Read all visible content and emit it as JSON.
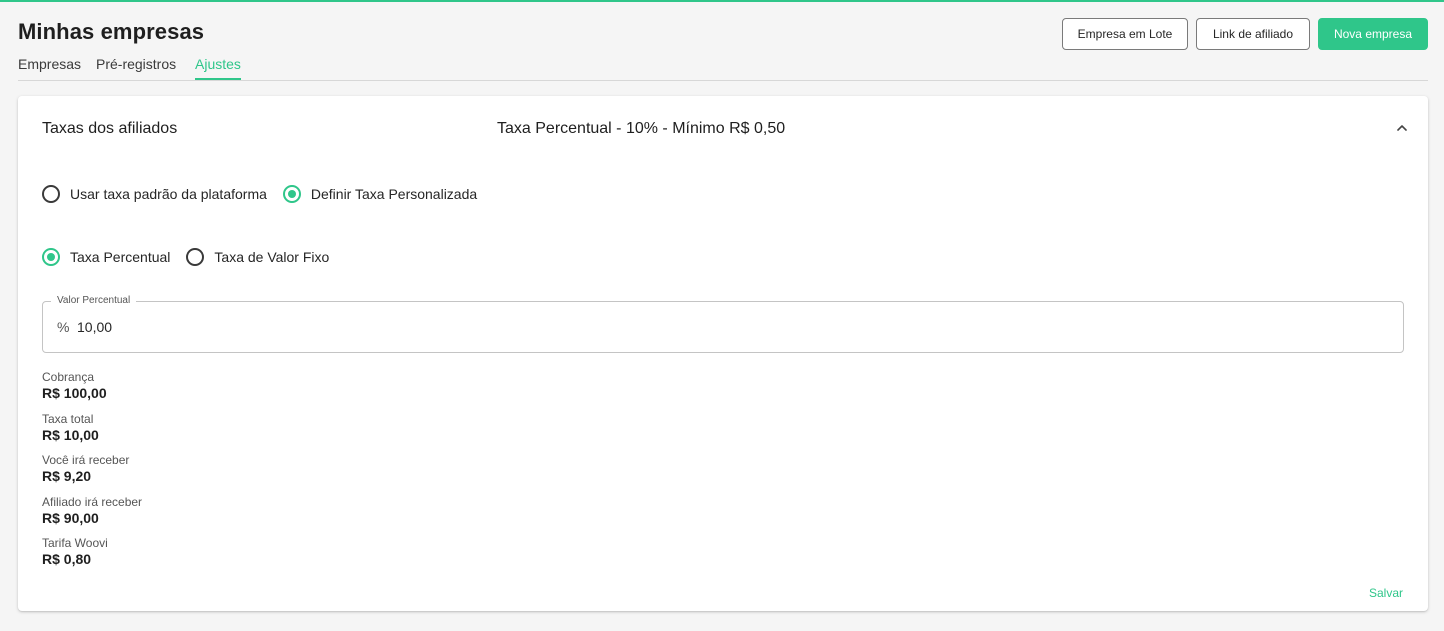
{
  "header": {
    "title": "Minhas empresas",
    "buttons": {
      "batch": "Empresa em Lote",
      "affiliate_link": "Link de afiliado",
      "new_company": "Nova empresa"
    }
  },
  "tabs": [
    {
      "label": "Empresas",
      "active": false
    },
    {
      "label": "Pré-registros",
      "active": false
    },
    {
      "label": "Ajustes",
      "active": true
    }
  ],
  "card": {
    "heading": "Taxas dos afiliados",
    "summary": "Taxa Percentual - 10% - Mínimo R$ 0,50",
    "fee_mode": {
      "options": [
        {
          "label": "Usar taxa padrão da plataforma",
          "selected": false
        },
        {
          "label": "Definir Taxa Personalizada",
          "selected": true
        }
      ]
    },
    "fee_type": {
      "options": [
        {
          "label": "Taxa Percentual",
          "selected": true
        },
        {
          "label": "Taxa de Valor Fixo",
          "selected": false
        }
      ]
    },
    "percent_field": {
      "label": "Valor Percentual",
      "prefix": "%",
      "value": "10,00"
    },
    "breakdown": [
      {
        "label": "Cobrança",
        "value": "R$ 100,00"
      },
      {
        "label": "Taxa total",
        "value": "R$ 10,00"
      },
      {
        "label": "Você irá receber",
        "value": "R$ 9,20"
      },
      {
        "label": "Afiliado irá receber",
        "value": "R$ 90,00"
      },
      {
        "label": "Tarifa Woovi",
        "value": "R$ 0,80"
      }
    ],
    "save_label": "Salvar"
  },
  "colors": {
    "accent": "#2fc68a",
    "text": "#1f1f1f",
    "muted": "#555555",
    "border": "#c4c4c4",
    "background": "#f5f5f5"
  },
  "icons": {
    "collapse": "chevron-up-icon"
  }
}
